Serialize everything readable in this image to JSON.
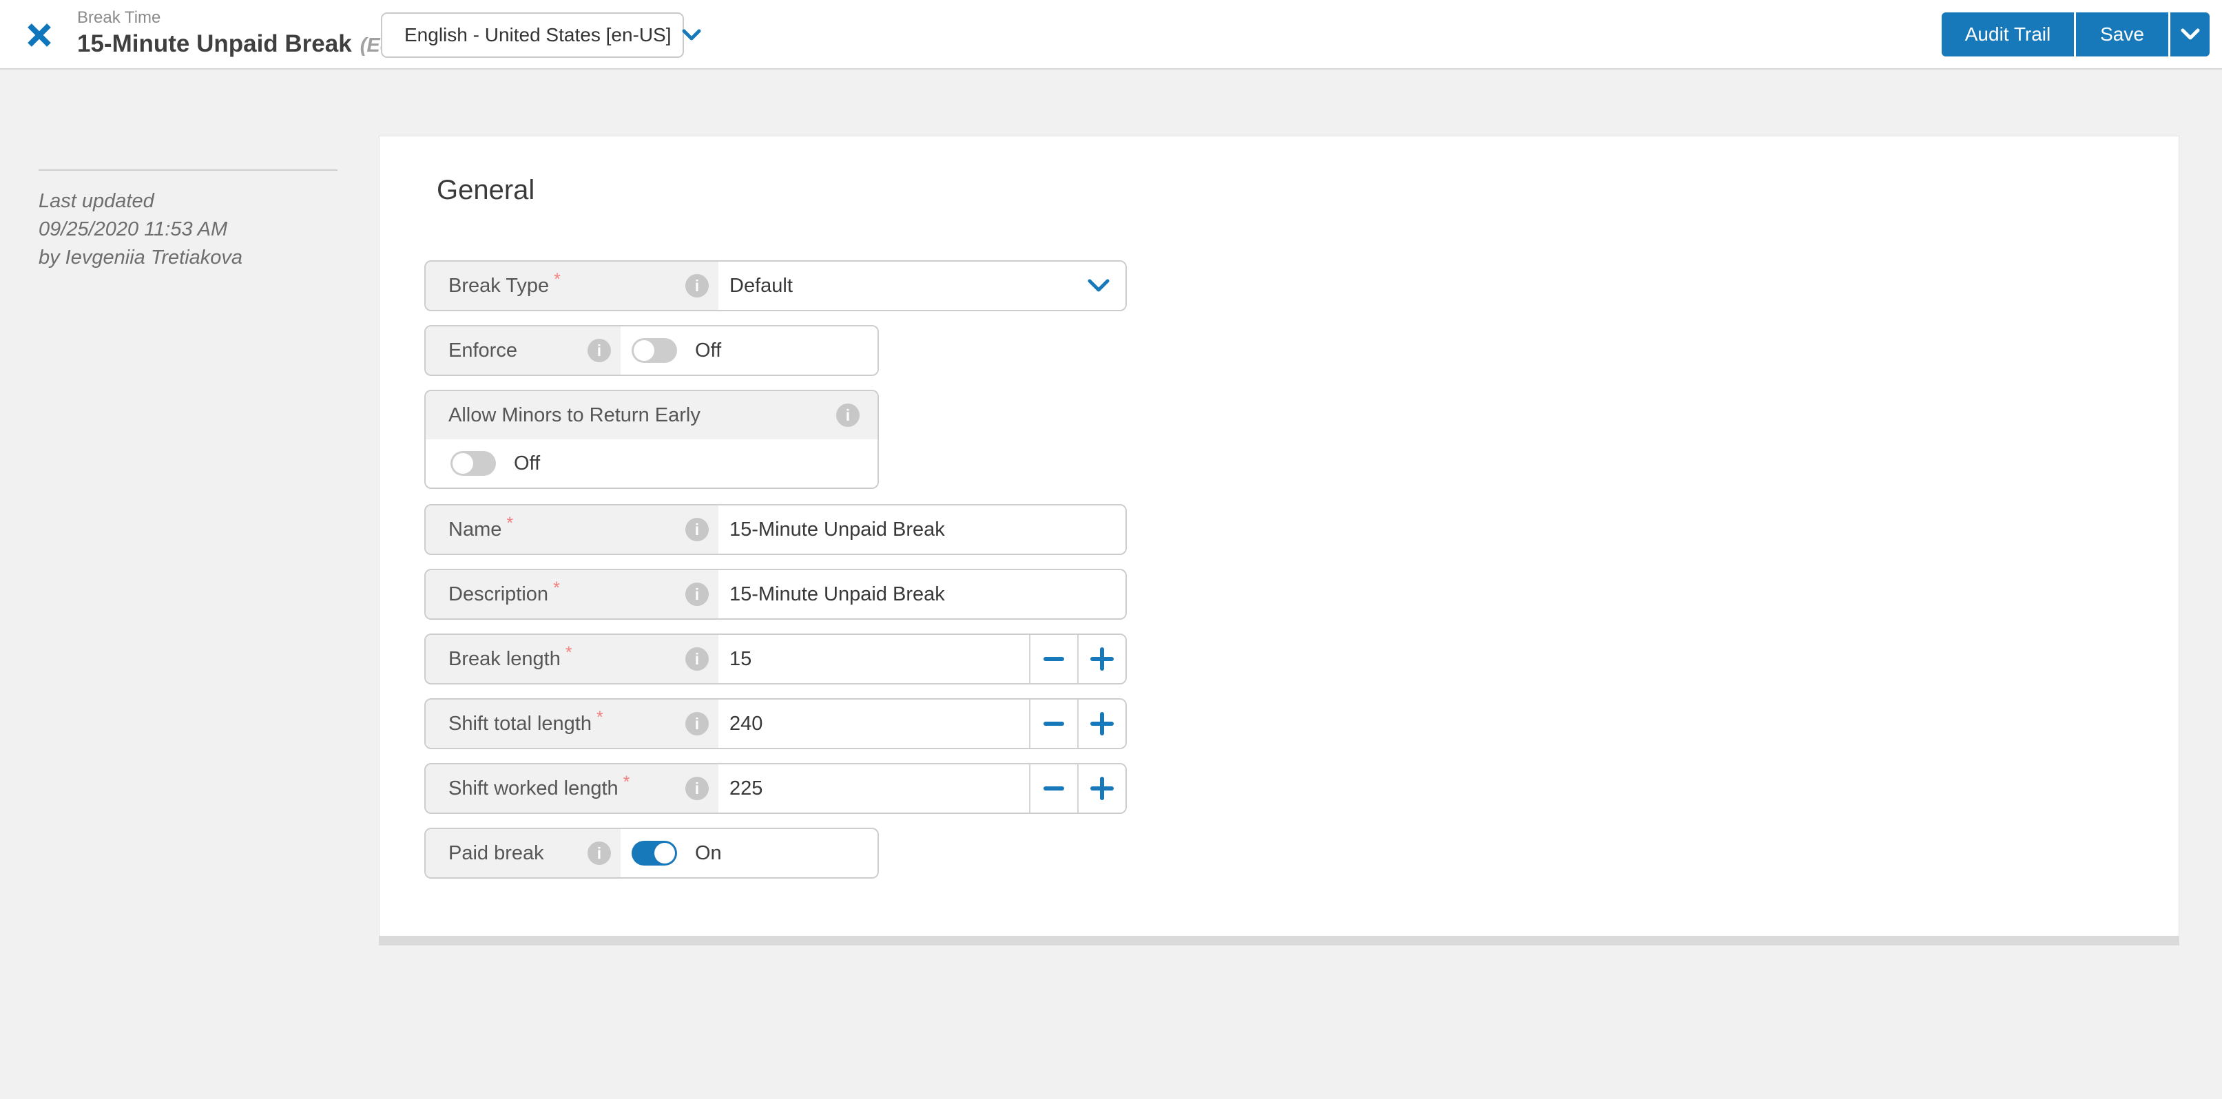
{
  "header": {
    "context_label": "Break Time",
    "title": "15-Minute Unpaid Break",
    "edited_tag": "(Edited)",
    "language": {
      "value": "English - United States [en-US]"
    },
    "audit_trail_label": "Audit Trail",
    "save_label": "Save"
  },
  "sidebar": {
    "last_updated_label": "Last updated",
    "last_updated_timestamp": "09/25/2020 11:53 AM",
    "last_updated_author": "by Ievgeniia Tretiakova"
  },
  "general": {
    "section_title": "General",
    "required_marker": "*",
    "fields": [
      {
        "label": "Break Type",
        "required": true,
        "type": "select",
        "value": "Default"
      },
      {
        "label": "Enforce",
        "required": false,
        "type": "toggle",
        "state": "Off"
      },
      {
        "label": "Allow Minors to Return Early",
        "required": false,
        "type": "toggle",
        "state": "Off"
      },
      {
        "label": "Name",
        "required": true,
        "type": "text",
        "value": "15-Minute Unpaid Break"
      },
      {
        "label": "Description",
        "required": true,
        "type": "text",
        "value": "15-Minute Unpaid Break"
      },
      {
        "label": "Break length",
        "required": true,
        "type": "stepper",
        "value": "15"
      },
      {
        "label": "Shift total length",
        "required": true,
        "type": "stepper",
        "value": "240"
      },
      {
        "label": "Shift worked length",
        "required": true,
        "type": "stepper",
        "value": "225"
      },
      {
        "label": "Paid break",
        "required": false,
        "type": "toggle",
        "state": "On"
      }
    ]
  },
  "icons": {
    "info_glyph": "i"
  },
  "colors": {
    "primary_blue": "#1779ba",
    "page_background": "#f1f1f1",
    "row_border": "#cdcdcd",
    "label_background": "#f1f1f1",
    "required_red": "#f28080",
    "info_icon_gray": "#c7c7c7",
    "toggle_off_gray": "#cdcdcd"
  }
}
